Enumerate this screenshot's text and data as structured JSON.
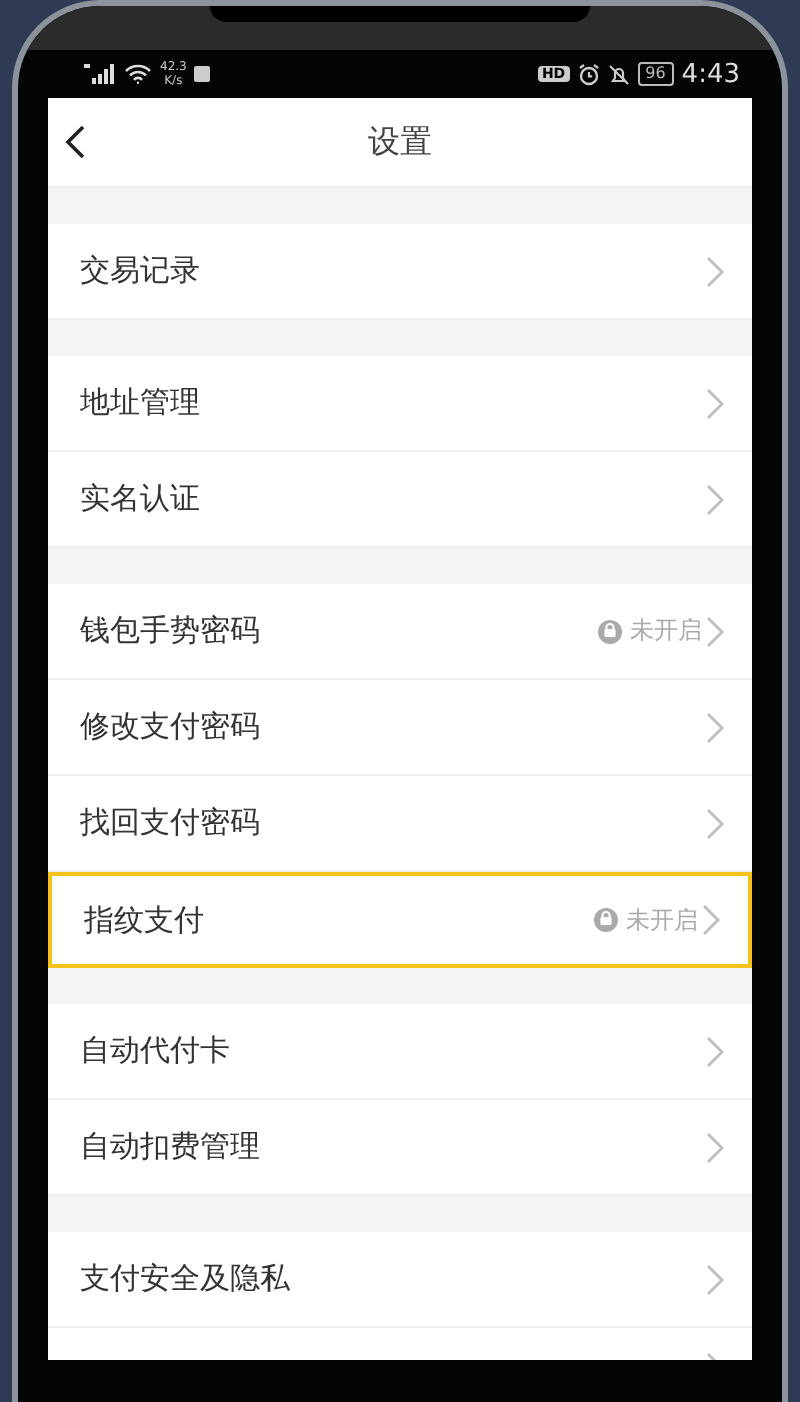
{
  "status_bar": {
    "network_speed": "42.3",
    "speed_unit": "K/s",
    "hd_badge": "HD",
    "battery": "96",
    "time": "4:43"
  },
  "header": {
    "title": "设置"
  },
  "groups": [
    {
      "items": [
        {
          "kind": "row",
          "label": "交易记录",
          "highlighted": false
        }
      ]
    },
    {
      "items": [
        {
          "kind": "row",
          "label": "地址管理",
          "highlighted": false
        },
        {
          "kind": "row",
          "label": "实名认证",
          "highlighted": false
        }
      ]
    },
    {
      "items": [
        {
          "kind": "row",
          "label": "钱包手势密码",
          "status": "未开启",
          "highlighted": false
        },
        {
          "kind": "row",
          "label": "修改支付密码",
          "highlighted": false
        },
        {
          "kind": "row",
          "label": "找回支付密码",
          "highlighted": false
        },
        {
          "kind": "row",
          "label": "指纹支付",
          "status": "未开启",
          "highlighted": true
        }
      ]
    },
    {
      "items": [
        {
          "kind": "row",
          "label": "自动代付卡",
          "highlighted": false
        },
        {
          "kind": "row",
          "label": "自动扣费管理",
          "highlighted": false
        }
      ]
    },
    {
      "items": [
        {
          "kind": "row",
          "label": "支付安全及隐私",
          "highlighted": false
        },
        {
          "kind": "partial",
          "highlighted": false
        }
      ]
    }
  ]
}
